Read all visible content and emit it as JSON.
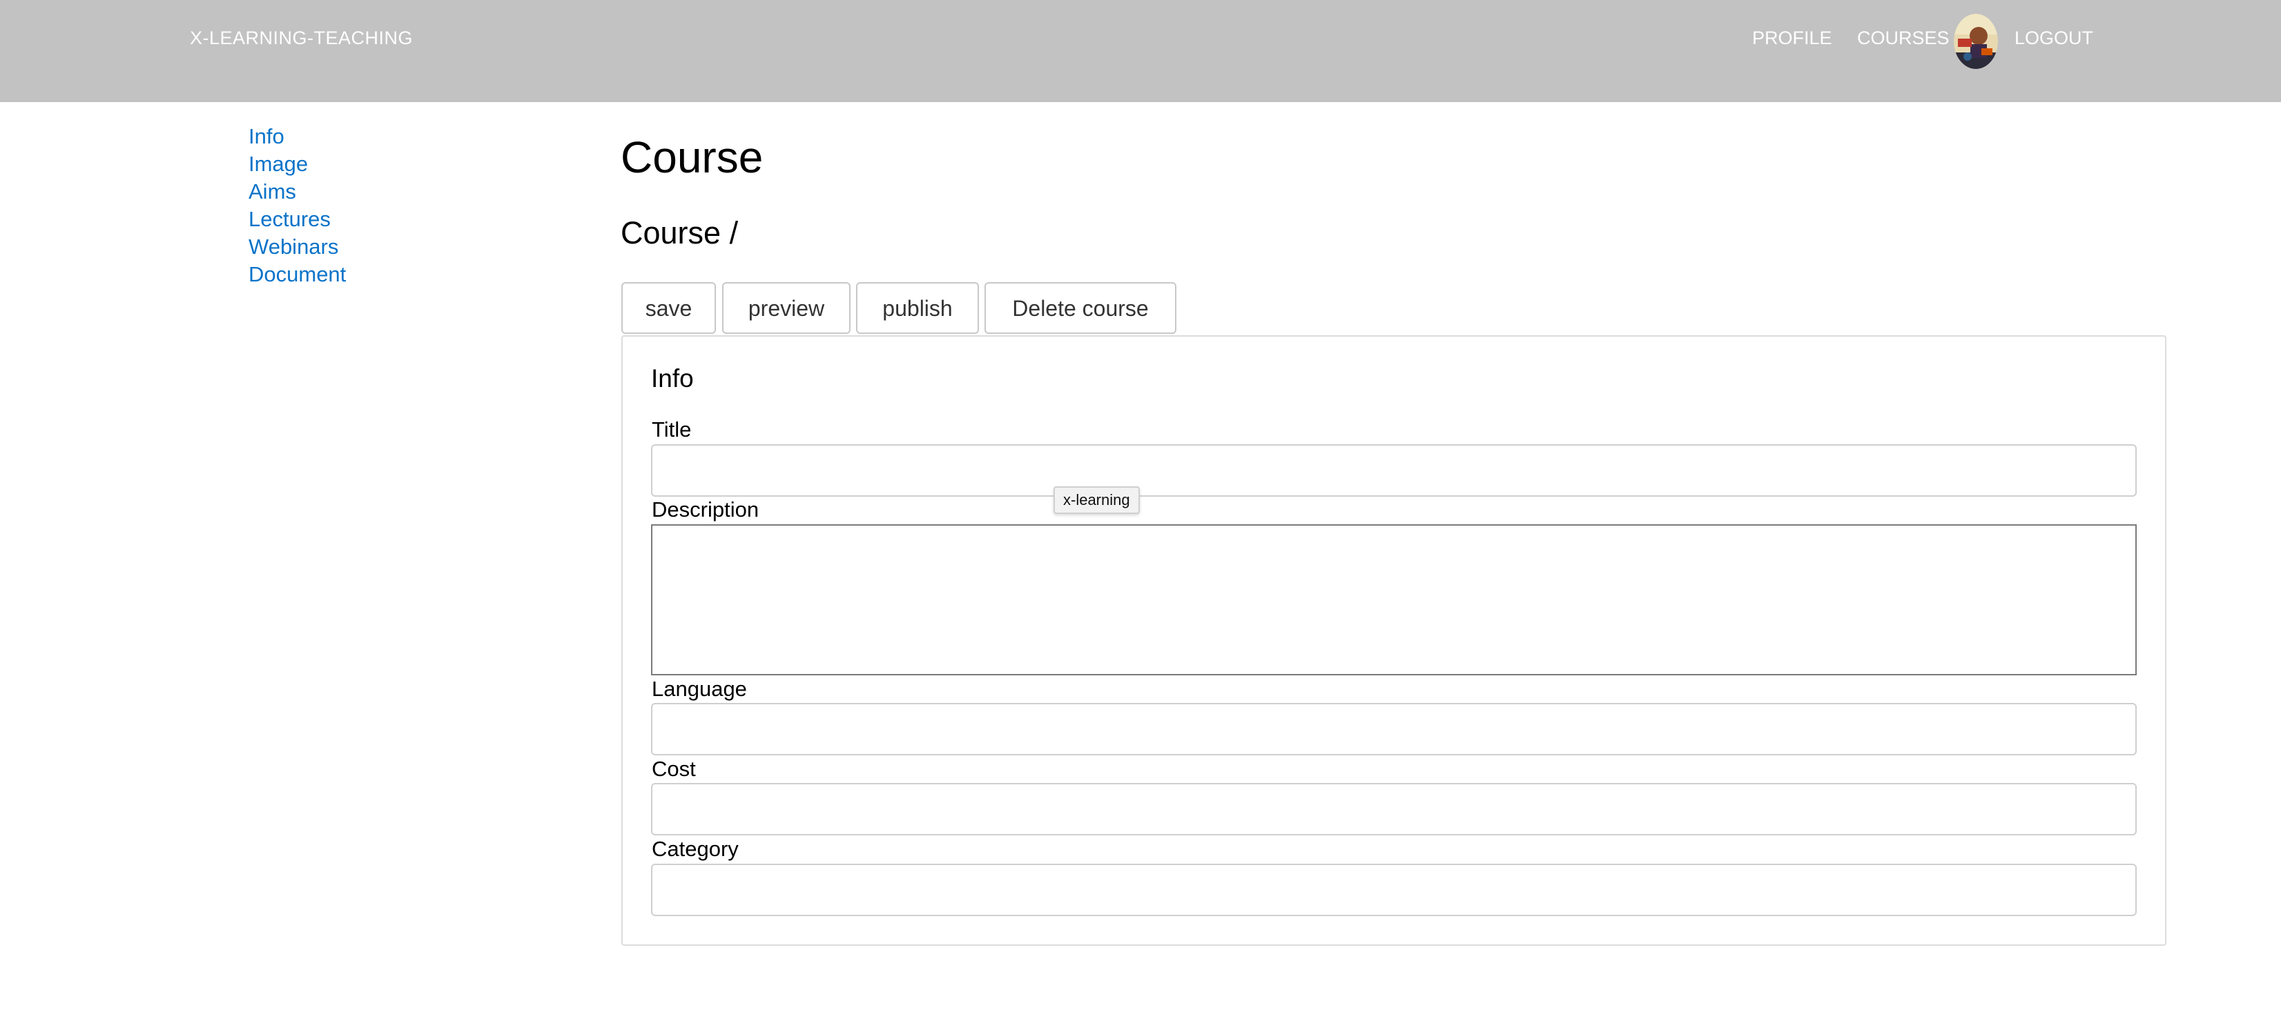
{
  "header": {
    "brand": "X-LEARNING-TEACHING",
    "nav": {
      "profile": "PROFILE",
      "courses": "COURSES",
      "logout": "LOGOUT"
    },
    "avatar_icon": "user-avatar-icon",
    "background_color": "#c2c2c2"
  },
  "sidebar": {
    "items": [
      {
        "label": "Info"
      },
      {
        "label": "Image"
      },
      {
        "label": "Aims"
      },
      {
        "label": "Lectures"
      },
      {
        "label": "Webinars"
      },
      {
        "label": "Document"
      }
    ],
    "link_color": "#0a73c9"
  },
  "main": {
    "title": "Course",
    "subtitle": "Course /",
    "toolbar": {
      "save": "save",
      "preview": "preview",
      "publish": "publish",
      "delete": "Delete course"
    },
    "panel": {
      "title": "Info",
      "fields": {
        "title": {
          "label": "Title",
          "value": ""
        },
        "description": {
          "label": "Description",
          "value": ""
        },
        "language": {
          "label": "Language",
          "value": ""
        },
        "cost": {
          "label": "Cost",
          "value": ""
        },
        "category": {
          "label": "Category",
          "value": ""
        }
      }
    },
    "tooltip": "x-learning"
  }
}
